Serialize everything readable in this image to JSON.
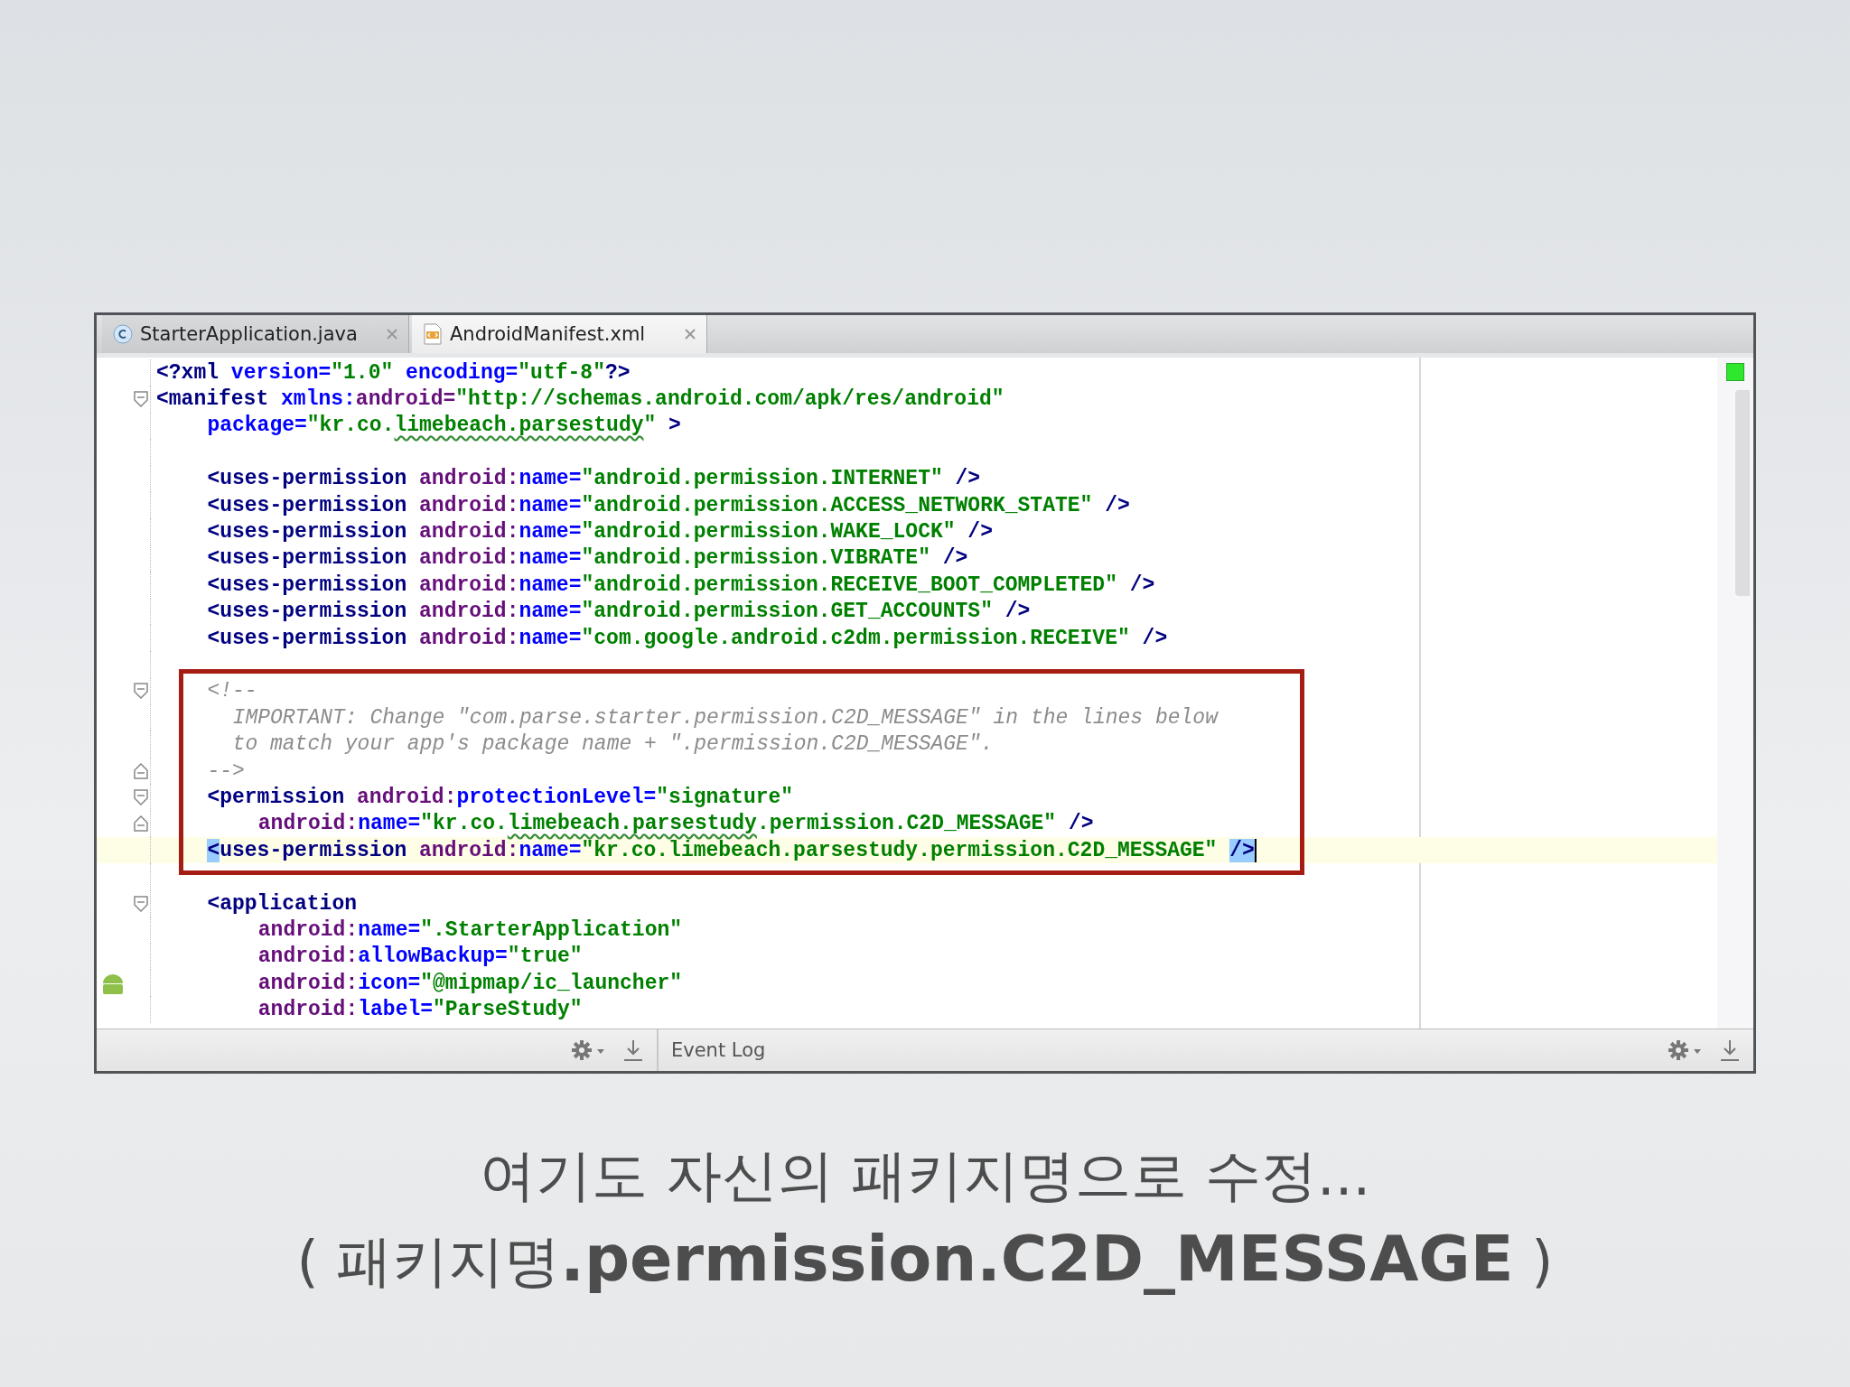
{
  "editor": {
    "tabs": [
      {
        "label": "StarterApplication.java",
        "selected": false
      },
      {
        "label": "AndroidManifest.xml",
        "selected": true
      }
    ],
    "blocks": [
      {
        "kind": "plain",
        "lines": [
          {
            "kind": "top",
            "tokens": [
              {
                "kind": "tag",
                "text": "<?xml "
              },
              {
                "kind": "attr",
                "text": "version="
              },
              {
                "kind": "value",
                "text": "\"1.0\" "
              },
              {
                "kind": "attr",
                "text": "encoding="
              },
              {
                "kind": "value",
                "text": "\"utf-8\""
              },
              {
                "kind": "tag",
                "text": "?>"
              }
            ]
          },
          {
            "kind": "top",
            "fold_start": true,
            "tokens": [
              {
                "kind": "tag",
                "text": "<manifest "
              },
              {
                "kind": "attr",
                "text": "xmlns:"
              },
              {
                "kind": "ns",
                "text": "android="
              },
              {
                "kind": "value",
                "text": "\"http://schemas.android.com/apk/res/android\""
              }
            ]
          },
          {
            "kind": "attribute",
            "tokens": [
              {
                "kind": "attr",
                "text": "package="
              },
              {
                "kind": "value",
                "text": "\"kr.co."
              },
              {
                "kind": "typo",
                "text": "limebeach.parsestudy"
              },
              {
                "kind": "value",
                "text": "\""
              },
              {
                "kind": "tag",
                "text": " >"
              }
            ]
          },
          {
            "kind": "blank"
          },
          {
            "kind": "element",
            "tokens": [
              {
                "kind": "tag",
                "text": "<uses-permission "
              },
              {
                "kind": "ns",
                "text": "android:"
              },
              {
                "kind": "attr",
                "text": "name="
              },
              {
                "kind": "value",
                "text": "\"android.permission.INTERNET\""
              },
              {
                "kind": "tag",
                "text": " />"
              }
            ]
          },
          {
            "kind": "element",
            "tokens": [
              {
                "kind": "tag",
                "text": "<uses-permission "
              },
              {
                "kind": "ns",
                "text": "android:"
              },
              {
                "kind": "attr",
                "text": "name="
              },
              {
                "kind": "value",
                "text": "\"android.permission.ACCESS_NETWORK_STATE\""
              },
              {
                "kind": "tag",
                "text": " />"
              }
            ]
          },
          {
            "kind": "element",
            "tokens": [
              {
                "kind": "tag",
                "text": "<uses-permission "
              },
              {
                "kind": "ns",
                "text": "android:"
              },
              {
                "kind": "attr",
                "text": "name="
              },
              {
                "kind": "value",
                "text": "\"android.permission.WAKE_LOCK\""
              },
              {
                "kind": "tag",
                "text": " />"
              }
            ]
          },
          {
            "kind": "element",
            "tokens": [
              {
                "kind": "tag",
                "text": "<uses-permission "
              },
              {
                "kind": "ns",
                "text": "android:"
              },
              {
                "kind": "attr",
                "text": "name="
              },
              {
                "kind": "value",
                "text": "\"android.permission.VIBRATE\""
              },
              {
                "kind": "tag",
                "text": " />"
              }
            ]
          },
          {
            "kind": "element",
            "tokens": [
              {
                "kind": "tag",
                "text": "<uses-permission "
              },
              {
                "kind": "ns",
                "text": "android:"
              },
              {
                "kind": "attr",
                "text": "name="
              },
              {
                "kind": "value",
                "text": "\"android.permission.RECEIVE_BOOT_COMPLETED\""
              },
              {
                "kind": "tag",
                "text": " />"
              }
            ]
          },
          {
            "kind": "element",
            "tokens": [
              {
                "kind": "tag",
                "text": "<uses-permission "
              },
              {
                "kind": "ns",
                "text": "android:"
              },
              {
                "kind": "attr",
                "text": "name="
              },
              {
                "kind": "value",
                "text": "\"android.permission.GET_ACCOUNTS\""
              },
              {
                "kind": "tag",
                "text": " />"
              }
            ]
          },
          {
            "kind": "element",
            "tokens": [
              {
                "kind": "tag",
                "text": "<uses-permission "
              },
              {
                "kind": "ns",
                "text": "android:"
              },
              {
                "kind": "attr",
                "text": "name="
              },
              {
                "kind": "value",
                "text": "\"com.google.android.c2dm.permission.RECEIVE\""
              },
              {
                "kind": "tag",
                "text": " />"
              }
            ]
          },
          {
            "kind": "blank"
          }
        ]
      },
      {
        "kind": "callout",
        "lines": [
          {
            "kind": "element",
            "fold_start": true,
            "tokens": [
              {
                "kind": "comment",
                "text": "<!--"
              }
            ]
          },
          {
            "kind": "comment",
            "tokens": [
              {
                "kind": "comment",
                "text": "IMPORTANT: Change \"com.parse.starter.permission.C2D_MESSAGE\" in the lines below"
              }
            ]
          },
          {
            "kind": "comment",
            "tokens": [
              {
                "kind": "comment",
                "text": "to match your app's package name + \".permission.C2D_MESSAGE\"."
              }
            ]
          },
          {
            "kind": "element",
            "fold_end": true,
            "tokens": [
              {
                "kind": "comment",
                "text": "-->"
              }
            ]
          },
          {
            "kind": "element",
            "fold_start": true,
            "tokens": [
              {
                "kind": "tag",
                "text": "<permission "
              },
              {
                "kind": "ns",
                "text": "android:"
              },
              {
                "kind": "attr",
                "text": "protectionLevel="
              },
              {
                "kind": "value",
                "text": "\"signature\""
              }
            ]
          },
          {
            "kind": "nested",
            "fold_end": true,
            "tokens": [
              {
                "kind": "ns",
                "text": "android:"
              },
              {
                "kind": "attr",
                "text": "name="
              },
              {
                "kind": "value",
                "text": "\"kr.co."
              },
              {
                "kind": "typo",
                "text": "limebeach.parsestudy"
              },
              {
                "kind": "value",
                "text": ".permission.C2D_MESSAGE\""
              },
              {
                "kind": "tag",
                "text": " />"
              }
            ]
          },
          {
            "kind": "element",
            "current": true,
            "cursor": true,
            "tokens": [
              {
                "kind": "match",
                "text": "<"
              },
              {
                "kind": "tag",
                "text": "uses-permission "
              },
              {
                "kind": "ns",
                "text": "android:"
              },
              {
                "kind": "attr",
                "text": "name="
              },
              {
                "kind": "value",
                "text": "\"kr.co.limebeach.parsestudy.permission.C2D_MESSAGE\" "
              },
              {
                "kind": "match",
                "text": "/>"
              }
            ]
          }
        ]
      },
      {
        "kind": "plain",
        "lines": [
          {
            "kind": "blank"
          },
          {
            "kind": "element",
            "fold_start": true,
            "tokens": [
              {
                "kind": "tag",
                "text": "<application"
              }
            ]
          },
          {
            "kind": "nested",
            "tokens": [
              {
                "kind": "ns",
                "text": "android:"
              },
              {
                "kind": "attr",
                "text": "name="
              },
              {
                "kind": "value",
                "text": "\".StarterApplication\""
              }
            ]
          },
          {
            "kind": "nested",
            "tokens": [
              {
                "kind": "ns",
                "text": "android:"
              },
              {
                "kind": "attr",
                "text": "allowBackup="
              },
              {
                "kind": "value",
                "text": "\"true\""
              }
            ]
          },
          {
            "kind": "nested",
            "android_icon": true,
            "tokens": [
              {
                "kind": "ns",
                "text": "android:"
              },
              {
                "kind": "attr",
                "text": "icon="
              },
              {
                "kind": "value",
                "text": "\"@mipmap/ic_launcher\""
              }
            ]
          },
          {
            "kind": "nested",
            "tokens": [
              {
                "kind": "ns",
                "text": "android:"
              },
              {
                "kind": "attr",
                "text": "label="
              },
              {
                "kind": "value",
                "text": "\"ParseStudy\""
              }
            ]
          }
        ]
      }
    ],
    "status_bar": {
      "event_log": "Event Log"
    }
  },
  "caption": {
    "lines": [
      "여기도 자신의 패키지명으로 수정...",
      "( 패키지명**.permission.C2D_MESSAGE** )"
    ]
  }
}
